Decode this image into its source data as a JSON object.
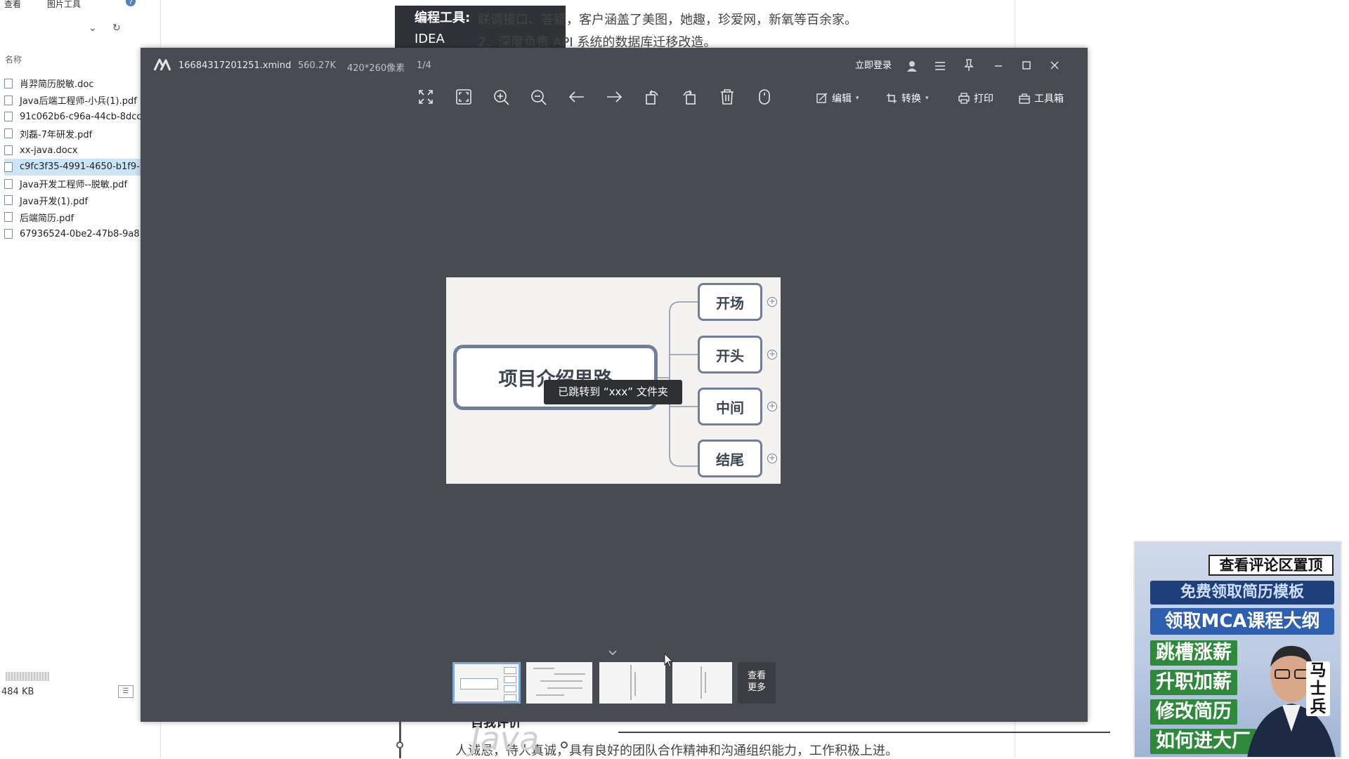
{
  "explorer": {
    "ribbon": [
      "查看",
      "图片工具"
    ],
    "column_header": "名称",
    "files": [
      "肖羿简历脱敏.doc",
      "Java后端工程师-小兵(1).pdf",
      "91c062b6-c96a-44cb-8dcc",
      "刘磊-7年研发.pdf",
      "xx-java.docx",
      "c9fc3f35-4991-4650-b1f9-",
      "Java开发工程师--脱敏.pdf",
      "Java开发(1).pdf",
      "后端简历.pdf",
      "67936524-0be2-47b8-9a8"
    ],
    "selected_index": 5,
    "status_size": "484 KB"
  },
  "document": {
    "tool_label": "编程工具:",
    "tool_value": "IDEA",
    "line1": "联调接口、答疑，客户涵盖了美图，她趣，珍爱网，新氧等百余家。",
    "line2": "2、深度负责 API 系统的数据库迁移改造。",
    "section_heading": "自我评价",
    "bottom_line": "人诚恳，待人真诚，具有良好的团队合作精神和沟通组织能力，工作积极上进。",
    "watermark": "Java"
  },
  "viewer": {
    "filename": "16684317201251.xmind",
    "filesize": "560.27K",
    "dimensions": "420*260像素",
    "page": "1/4",
    "login_label": "立即登录",
    "menus": {
      "edit": "编辑",
      "convert": "转换",
      "print": "打印",
      "toolbox": "工具箱"
    },
    "more_label_1": "查看",
    "more_label_2": "更多",
    "toast": "已跳转到 “xxx” 文件夹"
  },
  "mindmap": {
    "root": "项目介绍思路",
    "branches": [
      "开场",
      "开头",
      "中间",
      "结尾"
    ]
  },
  "promo": {
    "line1": "查看评论区置顶",
    "line2": "免费领取简历模板",
    "line3": "领取MCA课程大纲",
    "list": [
      "跳槽涨薪",
      "升职加薪",
      "修改简历",
      "如何进大厂"
    ],
    "brand": "马士兵"
  },
  "colors": {
    "viewer_bg": "#484b51",
    "node_border": "#6e7e9c",
    "thumb_active": "#7fa9d9",
    "toast_bg": "#2d2f33"
  }
}
